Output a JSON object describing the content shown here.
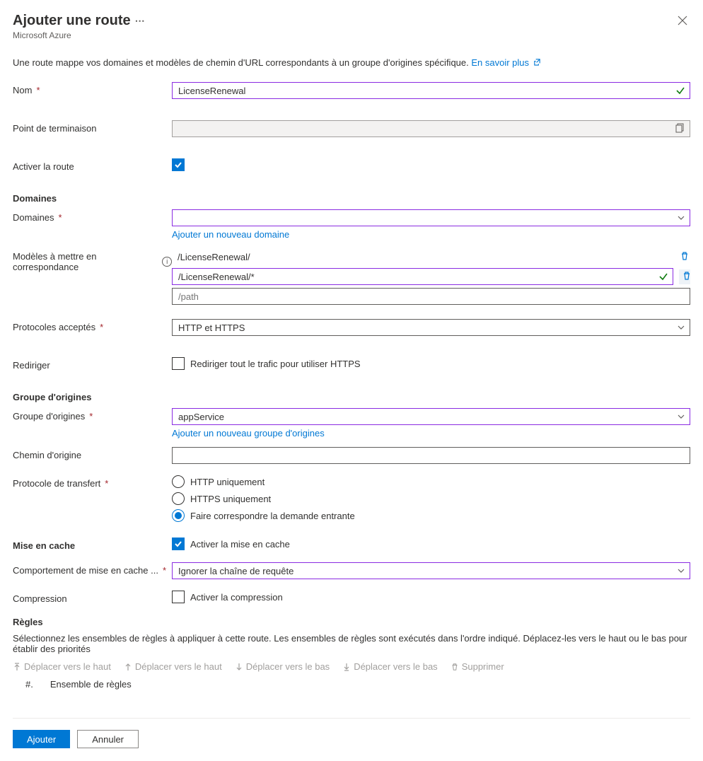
{
  "header": {
    "title": "Ajouter une route",
    "subtitle": "Microsoft Azure"
  },
  "intro": {
    "text": "Une route mappe vos domaines et modèles de chemin d'URL correspondants à un groupe d'origines spécifique. ",
    "link": "En savoir plus"
  },
  "labels": {
    "name": "Nom",
    "endpoint": "Point de terminaison",
    "enable_route": "Activer la route",
    "domains_section": "Domaines",
    "domains": "Domaines",
    "add_domain": "Ajouter un nouveau domaine",
    "patterns": "Modèles à mettre en correspondance",
    "accepted_protocols": "Protocoles acceptés",
    "redirect": "Rediriger",
    "redirect_cb": "Rediriger tout le trafic pour utiliser HTTPS",
    "origin_group_section": "Groupe d'origines",
    "origin_group": "Groupe d'origines",
    "add_origin_group": "Ajouter un nouveau groupe d'origines",
    "origin_path": "Chemin d'origine",
    "forwarding_protocol": "Protocole de transfert",
    "caching_section": "Mise en cache",
    "enable_caching": "Activer la mise en cache",
    "caching_behavior": "Comportement de mise en cache ...",
    "compression": "Compression",
    "enable_compression": "Activer la compression",
    "rules_section": "Règles",
    "rules_desc": "Sélectionnez les ensembles de règles à appliquer à cette route. Les ensembles de règles sont exécutés dans l'ordre indiqué. Déplacez-les vers le haut ou le bas pour établir des priorités"
  },
  "values": {
    "name": "LicenseRenewal",
    "domains": "",
    "pattern_static": "/LicenseRenewal/",
    "pattern_select": "/LicenseRenewal/*",
    "pattern_placeholder": "/path",
    "accepted_protocols": "HTTP et HTTPS",
    "origin_group": "appService",
    "origin_path": "",
    "caching_behavior": "Ignorer la chaîne de requête"
  },
  "radios": {
    "http_only": "HTTP uniquement",
    "https_only": "HTTPS uniquement",
    "match_incoming": "Faire correspondre la demande entrante"
  },
  "rules_toolbar": {
    "move_up1": "Déplacer vers le haut",
    "move_up2": "Déplacer vers le haut",
    "move_down1": "Déplacer vers le bas",
    "move_down2": "Déplacer vers le bas",
    "delete": "Supprimer"
  },
  "rules_columns": {
    "num": "#.",
    "ruleset": "Ensemble de règles"
  },
  "footer": {
    "add": "Ajouter",
    "cancel": "Annuler"
  }
}
